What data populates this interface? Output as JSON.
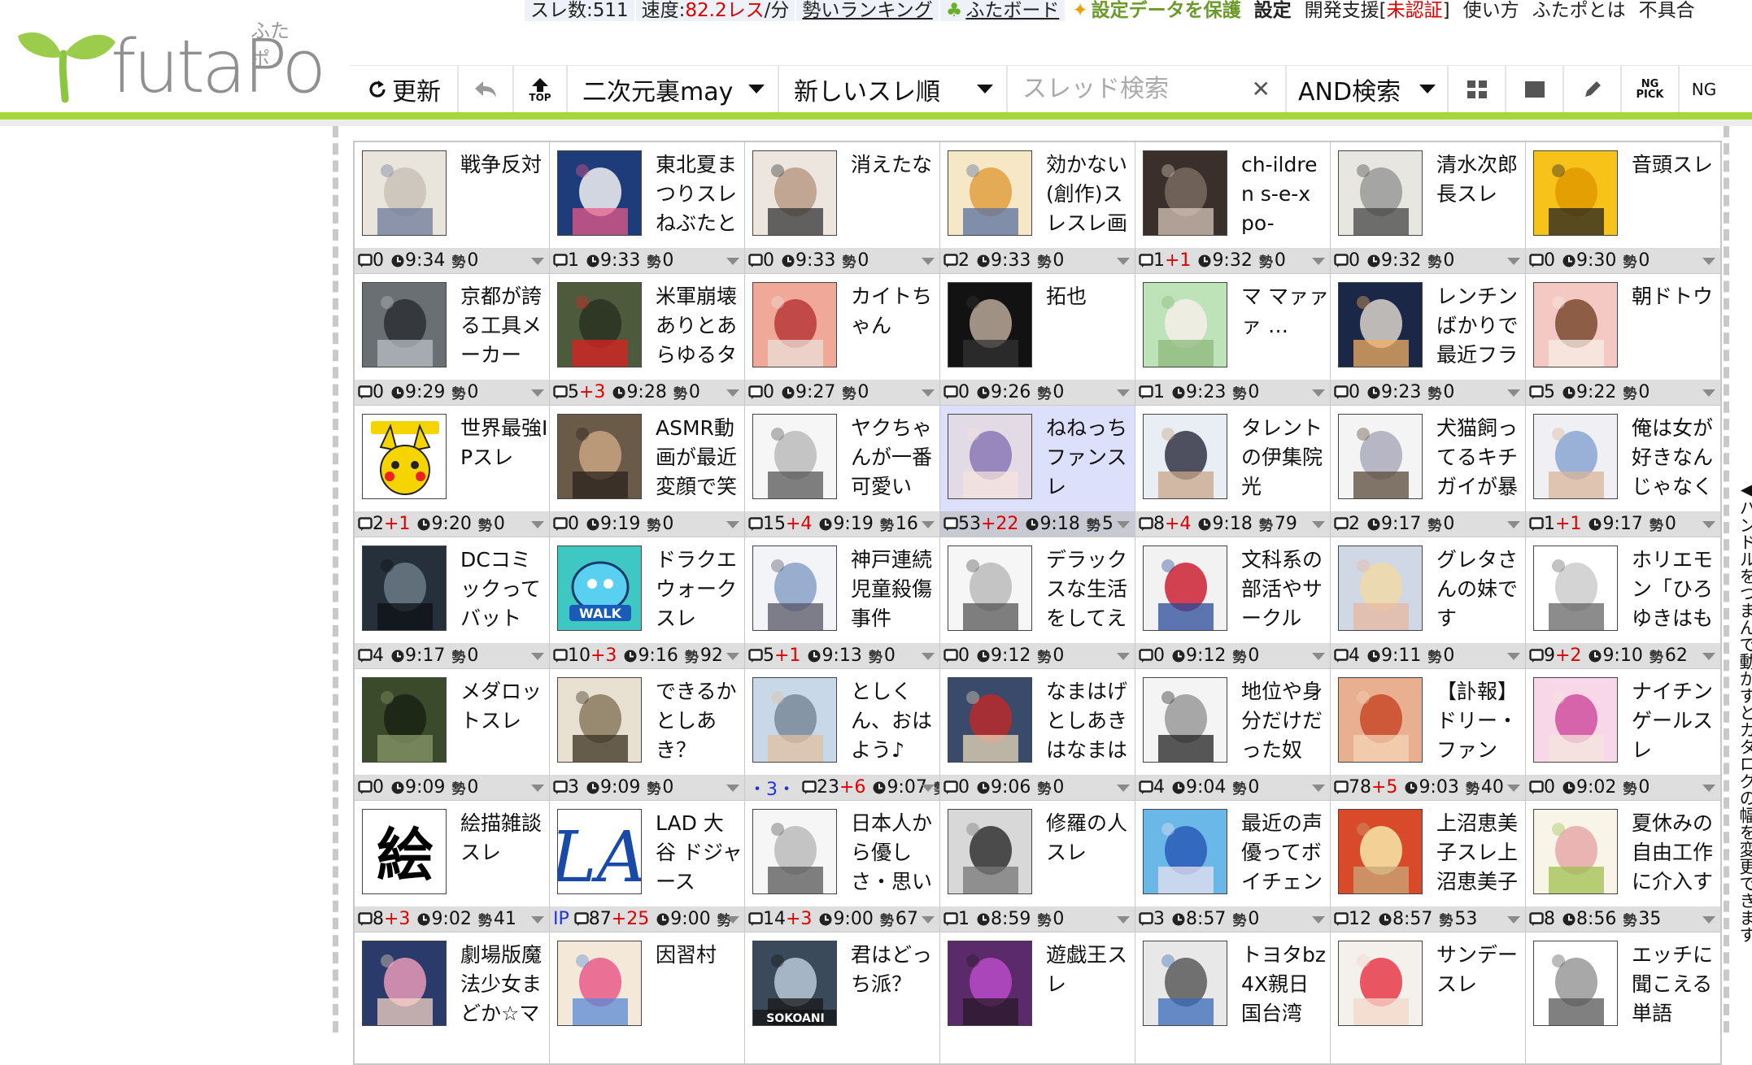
{
  "topbar": {
    "thread_count": "スレ数:511",
    "speed_label": "速度:",
    "speed_value": "82.2レス",
    "speed_unit": "/分",
    "ranking": "勢いランキング",
    "board": "ふたボード",
    "protect": "設定データを保護",
    "settings": "設定",
    "dev": "開発支援[",
    "unauth": "未認証",
    "dev_end": "]",
    "usage": "使い方",
    "about": "ふたポとは",
    "bugs": "不具合"
  },
  "logo": {
    "main": "futaPo",
    "kana": "ふたポ"
  },
  "toolbar": {
    "refresh": "更新",
    "top": "TOP",
    "board": "二次元裏may",
    "sort": "新しいスレ順",
    "search_placeholder": "スレッド検索",
    "search_mode": "AND検索",
    "ngpick": "NG PICK",
    "ng": "NG"
  },
  "sidebar_text": "ハンドルをつまんで動かすとカタログの幅を変更できます",
  "accent": "#a5d63a",
  "threads": [
    {
      "title": "戦争反対",
      "res": "0",
      "plus": "",
      "time": "9:34",
      "sei": "0",
      "thumb": "robots"
    },
    {
      "title": "東北夏まつりスレねぶたと",
      "res": "1",
      "plus": "",
      "time": "9:33",
      "sei": "0",
      "thumb": "mascots"
    },
    {
      "title": "消えたな",
      "res": "0",
      "plus": "",
      "time": "9:33",
      "sei": "0",
      "thumb": "face"
    },
    {
      "title": "効かない(創作)スレスレ画",
      "res": "2",
      "plus": "",
      "time": "9:33",
      "sei": "0",
      "thumb": "hero"
    },
    {
      "title": "ch-ildren s-e-x po-",
      "res": "1",
      "plus": "+1",
      "time": "9:32",
      "sei": "0",
      "thumb": "dark"
    },
    {
      "title": "清水次郎長スレ",
      "res": "0",
      "plus": "",
      "time": "9:32",
      "sei": "0",
      "thumb": "oldphoto"
    },
    {
      "title": "音頭スレ",
      "res": "0",
      "plus": "",
      "time": "9:30",
      "sei": "0",
      "thumb": "yellow"
    },
    {
      "title": "京都が誇る工具メーカー",
      "res": "0",
      "plus": "",
      "time": "9:29",
      "sei": "0",
      "thumb": "tools"
    },
    {
      "title": "米軍崩壊ありとあらゆるタ",
      "res": "5",
      "plus": "+3",
      "time": "9:28",
      "sei": "0",
      "thumb": "flags"
    },
    {
      "title": "カイトちゃん",
      "res": "0",
      "plus": "",
      "time": "9:27",
      "sei": "0",
      "thumb": "anime-red"
    },
    {
      "title": "拓也",
      "res": "0",
      "plus": "",
      "time": "9:26",
      "sei": "0",
      "thumb": "statue"
    },
    {
      "title": "マ マァァァ …",
      "res": "1",
      "plus": "",
      "time": "9:23",
      "sei": "0",
      "thumb": "green"
    },
    {
      "title": "レンチンばかりで最近フラ",
      "res": "0",
      "plus": "",
      "time": "9:23",
      "sei": "0",
      "thumb": "space"
    },
    {
      "title": "朝ドトウ",
      "res": "5",
      "plus": "",
      "time": "9:22",
      "sei": "0",
      "thumb": "anime-pink"
    },
    {
      "title": "世界最強IPスレ",
      "res": "2",
      "plus": "+1",
      "time": "9:20",
      "sei": "0",
      "thumb": "pika"
    },
    {
      "title": "ASMR動画が最近変顔で笑",
      "res": "0",
      "plus": "",
      "time": "9:19",
      "sei": "0",
      "thumb": "people"
    },
    {
      "title": "ヤクちゃんが一番可愛い",
      "res": "15",
      "plus": "+4",
      "time": "9:19",
      "sei": "16",
      "thumb": "manga"
    },
    {
      "title": "ねねっちファンスレ",
      "res": "53",
      "plus": "+22",
      "time": "9:18",
      "sei": "5",
      "thumb": "anime-purple",
      "hl": true
    },
    {
      "title": "タレントの伊集院光",
      "res": "8",
      "plus": "+4",
      "time": "9:18",
      "sei": "79",
      "thumb": "man"
    },
    {
      "title": "犬猫飼ってるキチガイが暴",
      "res": "2",
      "plus": "",
      "time": "9:17",
      "sei": "0",
      "thumb": "tweet"
    },
    {
      "title": "俺は女が好きなんじゃなく",
      "res": "1",
      "plus": "+1",
      "time": "9:17",
      "sei": "0",
      "thumb": "girl"
    },
    {
      "title": "DCコミックってバット",
      "res": "4",
      "plus": "",
      "time": "9:17",
      "sei": "0",
      "thumb": "batman"
    },
    {
      "title": "ドラクエウォークスレ",
      "res": "10",
      "plus": "+3",
      "time": "9:16",
      "sei": "92",
      "thumb": "walk"
    },
    {
      "title": "神戸連続児童殺傷事件",
      "res": "5",
      "plus": "+1",
      "time": "9:13",
      "sei": "0",
      "thumb": "doc"
    },
    {
      "title": "デラックスな生活をしてえ",
      "res": "0",
      "plus": "",
      "time": "9:12",
      "sei": "0",
      "thumb": "manga"
    },
    {
      "title": "文科系の部活やサークル",
      "res": "0",
      "plus": "",
      "time": "9:12",
      "sei": "0",
      "thumb": "wonder"
    },
    {
      "title": "グレタさんの妹です",
      "res": "4",
      "plus": "",
      "time": "9:11",
      "sei": "0",
      "thumb": "blonde"
    },
    {
      "title": "ホリエモン「ひろゆきはも",
      "res": "9",
      "plus": "+2",
      "time": "9:10",
      "sei": "62",
      "thumb": "tweet2"
    },
    {
      "title": "メダロットスレ",
      "res": "0",
      "plus": "",
      "time": "9:09",
      "sei": "0",
      "thumb": "forest"
    },
    {
      "title": "できるかとしあき？",
      "res": "3",
      "plus": "",
      "time": "9:09",
      "sei": "0",
      "thumb": "sketch"
    },
    {
      "title": "としくん、おはよう♪",
      "res": "23",
      "plus": "+6",
      "time": "9:07",
      "sei": "",
      "thumb": "school",
      "dots": "・3・"
    },
    {
      "title": "なまはげとしあきはなまは",
      "res": "0",
      "plus": "",
      "time": "9:06",
      "sei": "0",
      "thumb": "masks"
    },
    {
      "title": "地位や身分だけだった奴",
      "res": "4",
      "plus": "",
      "time": "9:04",
      "sei": "0",
      "thumb": "manga2"
    },
    {
      "title": "【訃報】ドリー・ファン",
      "res": "78",
      "plus": "+5",
      "time": "9:03",
      "sei": "40",
      "thumb": "wrestler"
    },
    {
      "title": "ナイチンゲールスレ",
      "res": "0",
      "plus": "",
      "time": "9:02",
      "sei": "0",
      "thumb": "anime-pink2"
    },
    {
      "title": "絵描雑談スレ",
      "res": "8",
      "plus": "+3",
      "time": "9:02",
      "sei": "41",
      "thumb": "kanji"
    },
    {
      "title": "LAD 大谷 ドジャース",
      "res": "87",
      "plus": "+25",
      "time": "9:00",
      "sei": "",
      "thumb": "la",
      "ip": "IP"
    },
    {
      "title": "日本人から優しさ・思い",
      "res": "14",
      "plus": "+3",
      "time": "9:00",
      "sei": "67",
      "thumb": "manga"
    },
    {
      "title": "修羅の人スレ",
      "res": "1",
      "plus": "",
      "time": "8:59",
      "sei": "0",
      "thumb": "bw"
    },
    {
      "title": "最近の声優ってボイチェン",
      "res": "3",
      "plus": "",
      "time": "8:57",
      "sei": "0",
      "thumb": "vtuber"
    },
    {
      "title": "上沼恵美子スレ上沼恵美子",
      "res": "12",
      "plus": "",
      "time": "8:57",
      "sei": "53",
      "thumb": "tv"
    },
    {
      "title": "夏休みの自由工作に介入す",
      "res": "8",
      "plus": "",
      "time": "8:56",
      "sei": "35",
      "thumb": "kid"
    },
    {
      "title": "劇場版魔法少女まどか☆マ",
      "res": "",
      "plus": "",
      "time": "",
      "sei": "",
      "thumb": "madoka"
    },
    {
      "title": "因習村",
      "res": "",
      "plus": "",
      "time": "",
      "sei": "",
      "thumb": "collage"
    },
    {
      "title": "君はどっち派？",
      "res": "",
      "plus": "",
      "time": "",
      "sei": "",
      "thumb": "sokoani",
      "caption": "SOKOANI"
    },
    {
      "title": "遊戯王スレ",
      "res": "",
      "plus": "",
      "time": "",
      "sei": "",
      "thumb": "card"
    },
    {
      "title": "トヨタbz4X親日国台湾",
      "res": "",
      "plus": "",
      "time": "",
      "sei": "",
      "thumb": "news"
    },
    {
      "title": "サンデースレ",
      "res": "",
      "plus": "",
      "time": "",
      "sei": "",
      "thumb": "magazine"
    },
    {
      "title": "エッチに聞こえる単語",
      "res": "",
      "plus": "",
      "time": "",
      "sei": "",
      "thumb": "sketch2"
    }
  ]
}
